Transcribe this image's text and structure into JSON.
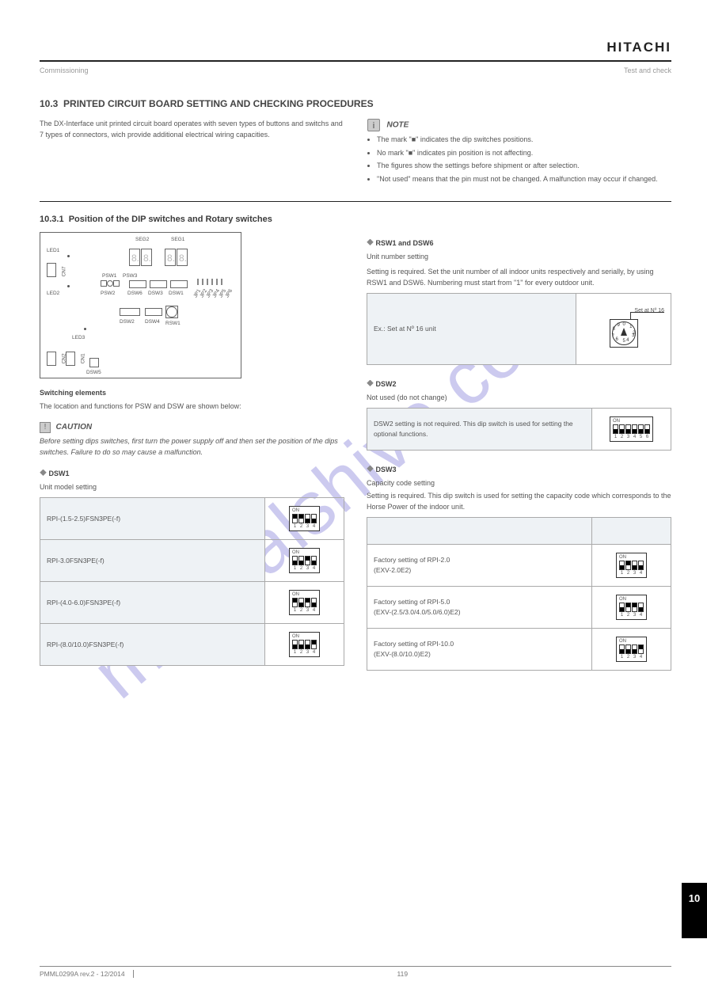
{
  "brand": "HITACHI",
  "header": {
    "left": "Commissioning",
    "right": "Test and check"
  },
  "section_num": "10.3",
  "section_title": "PRINTED CIRCUIT BOARD SETTING AND CHECKING PROCEDURES",
  "intro_left": "The DX-Interface unit printed circuit board operates with seven types of buttons and switchs and 7 types of connectors, wich provide additional electrical wiring capacities.",
  "note": {
    "label": "NOTE",
    "lines": [
      "The mark \"■\" indicates the dip switches positions.",
      "No mark \"■\" indicates pin position is not affecting.",
      "The figures show the settings before shipment or after selection.",
      "\"Not used\" means that the pin must not be changed. A malfunction may occur if changed."
    ]
  },
  "subsection_num": "10.3.1",
  "subsection_title": "Position of the DIP switches and Rotary switches",
  "left": {
    "pcb": {
      "seg2": "SEG2",
      "seg1": "SEG1",
      "led1": "LED1",
      "led2": "LED2",
      "led3": "LED3",
      "cn7": "CN7",
      "cn1": "CN1",
      "cn2": "CN2",
      "psw1": "PSW1",
      "psw2": "PSW2",
      "psw3": "PSW3",
      "dsw6": "DSW6",
      "dsw3": "DSW3",
      "dsw1": "DSW1",
      "dsw2": "DSW2",
      "dsw4": "DSW4",
      "dsw5": "DSW5",
      "rsw1": "RSW1",
      "jp": [
        "JP1",
        "JP2",
        "JP3",
        "JP4",
        "JP5",
        "JP6"
      ]
    },
    "switching_elements": {
      "title": "Switching elements",
      "text": "The location and functions for PSW and DSW are shown below:"
    },
    "caution": {
      "label": "CAUTION",
      "text": "Before setting dips switches, first turn the power supply off and then set the position of the dips switches. Failure to do so may cause a malfunction."
    },
    "dsw1": {
      "title": "DSW1",
      "subtitle": "Unit model setting",
      "rows": [
        {
          "label": "RPI-(1.5-2.5)FSN3PE(-f)",
          "dip": [
            1,
            1,
            0,
            0
          ]
        },
        {
          "label": "RPI-3.0FSN3PE(-f)",
          "dip": [
            0,
            0,
            1,
            0
          ]
        },
        {
          "label": "RPI-(4.0-6.0)FSN3PE(-f)",
          "dip": [
            1,
            0,
            1,
            0
          ]
        },
        {
          "label": "RPI-(8.0/10.0)FSN3PE(-f)",
          "dip": [
            0,
            0,
            0,
            1
          ]
        }
      ]
    }
  },
  "right": {
    "rsw1": {
      "title": "RSW1 and DSW6",
      "subtitle": "Unit number setting",
      "text1": "Setting is required. Set the unit number of all indoor units respectively and serially, by using RSW1 and DSW6. Numbering must start from \"1\" for every outdoor unit.",
      "table_label": "Ex.: Set at Nº 16 unit",
      "leader": "Set at Nº 16"
    },
    "dsw2": {
      "title": "DSW2",
      "subtitle": "Not used (do not change)",
      "text": "DSW2 setting is not required. This dip switch is used for setting the optional functions.",
      "dip": [
        0,
        0,
        0,
        0,
        0,
        0
      ]
    },
    "dsw3": {
      "title": "DSW3",
      "subtitle": "Capacity code setting",
      "text": "Setting is required. This dip switch is used for setting the capacity code which corresponds to the Horse Power of the indoor unit.",
      "rows": [
        {
          "label": "Factory setting of RPI-2.0",
          "label2": "(EXV-2.0E2)",
          "dip": [
            0,
            1,
            0,
            0
          ]
        },
        {
          "label": "Factory setting of RPI-5.0",
          "label2": "(EXV-(2.5/3.0/4.0/5.0/6.0)E2)",
          "dip": [
            0,
            1,
            1,
            0
          ]
        },
        {
          "label": "Factory setting of RPI-10.0",
          "label2": "(EXV-(8.0/10.0)E2)",
          "dip": [
            0,
            0,
            0,
            1
          ]
        }
      ]
    }
  },
  "footer": {
    "left": "PMML0299A rev.2 - 12/2014",
    "mid": "119",
    "right": ""
  },
  "side_tab": "10",
  "watermark": "manualshive.com"
}
